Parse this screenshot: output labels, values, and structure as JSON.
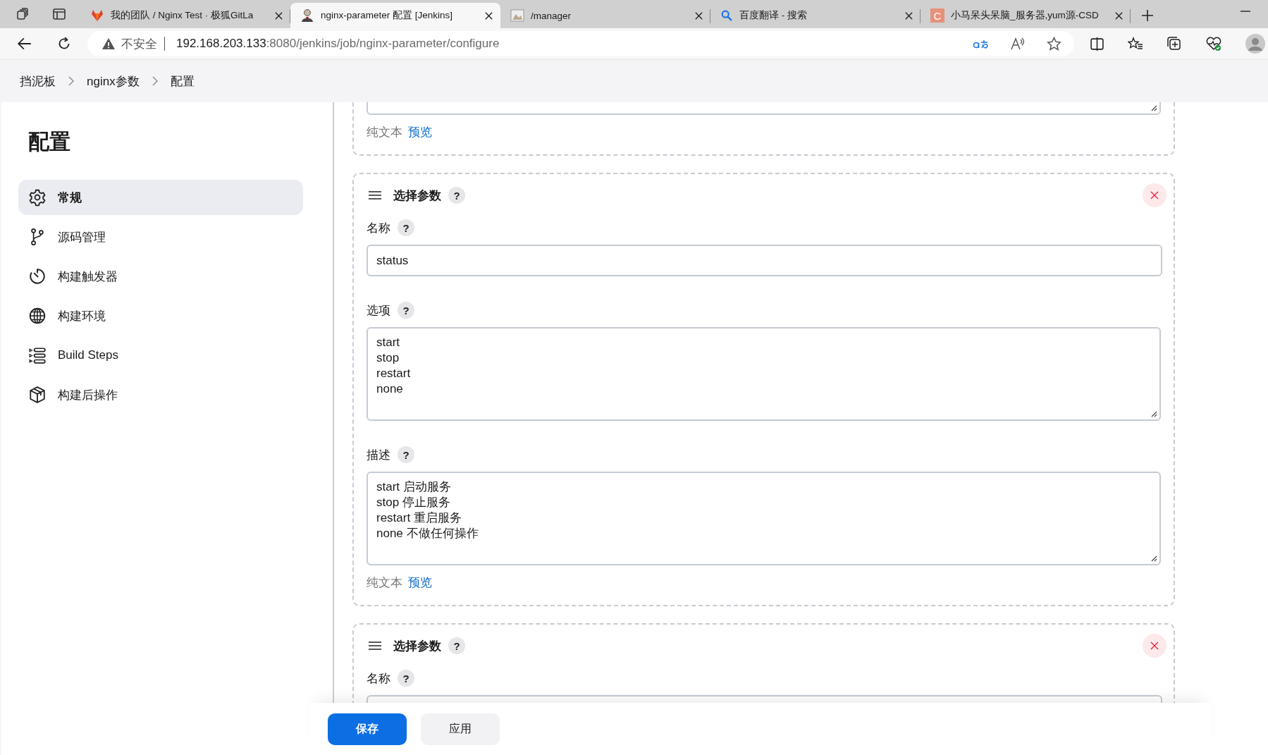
{
  "browser": {
    "tabs": [
      {
        "title": "我的团队 / Nginx Test · 极狐GitLa",
        "kind": "fox",
        "selected": false
      },
      {
        "title": "nginx-parameter 配置 [Jenkins]",
        "kind": "figure",
        "selected": true
      },
      {
        "title": "/manager",
        "kind": "image",
        "selected": false
      },
      {
        "title": "百度翻译 - 搜索",
        "kind": "search",
        "selected": false
      },
      {
        "title": "小马呆头呆脑_服务器,yum源-CSD",
        "kind": "letter",
        "icon_text": "C",
        "selected": false
      }
    ],
    "address": {
      "warning": "不安全",
      "host": "192.168.203.133",
      "path": ":8080/jenkins/job/nginx-parameter/configure"
    }
  },
  "breadcrumbs": [
    "挡泥板",
    "nginx参数",
    "配置"
  ],
  "sidebar": {
    "title": "配置",
    "items": [
      {
        "label": "常规",
        "kind": "gear",
        "selected": true
      },
      {
        "label": "源码管理",
        "kind": "branch",
        "selected": false
      },
      {
        "label": "构建触发器",
        "kind": "timer",
        "selected": false
      },
      {
        "label": "构建环境",
        "kind": "globe",
        "selected": false
      },
      {
        "label": "Build Steps",
        "kind": "steps",
        "selected": false
      },
      {
        "label": "构建后操作",
        "kind": "box",
        "selected": false
      }
    ]
  },
  "partial_card": {
    "footer": {
      "plain_text": "纯文本",
      "preview": "预览"
    }
  },
  "cards": [
    {
      "title": "选择参数",
      "help": "?",
      "fields": [
        {
          "label": "名称",
          "help": "?",
          "kind": "input",
          "value": "status"
        },
        {
          "label": "选项",
          "help": "?",
          "kind": "textarea",
          "value": "start\nstop\nrestart\nnone"
        },
        {
          "label": "描述",
          "help": "?",
          "kind": "textarea",
          "value": "start 启动服务\nstop 停止服务\nrestart 重启服务\nnone 不做任何操作"
        }
      ],
      "footer": {
        "plain_text": "纯文本",
        "preview": "预览"
      }
    },
    {
      "title": "选择参数",
      "help": "?",
      "fields": [
        {
          "label": "名称",
          "help": "?",
          "kind": "input"
        }
      ]
    }
  ],
  "buttons": {
    "save": "保存",
    "apply": "应用"
  }
}
